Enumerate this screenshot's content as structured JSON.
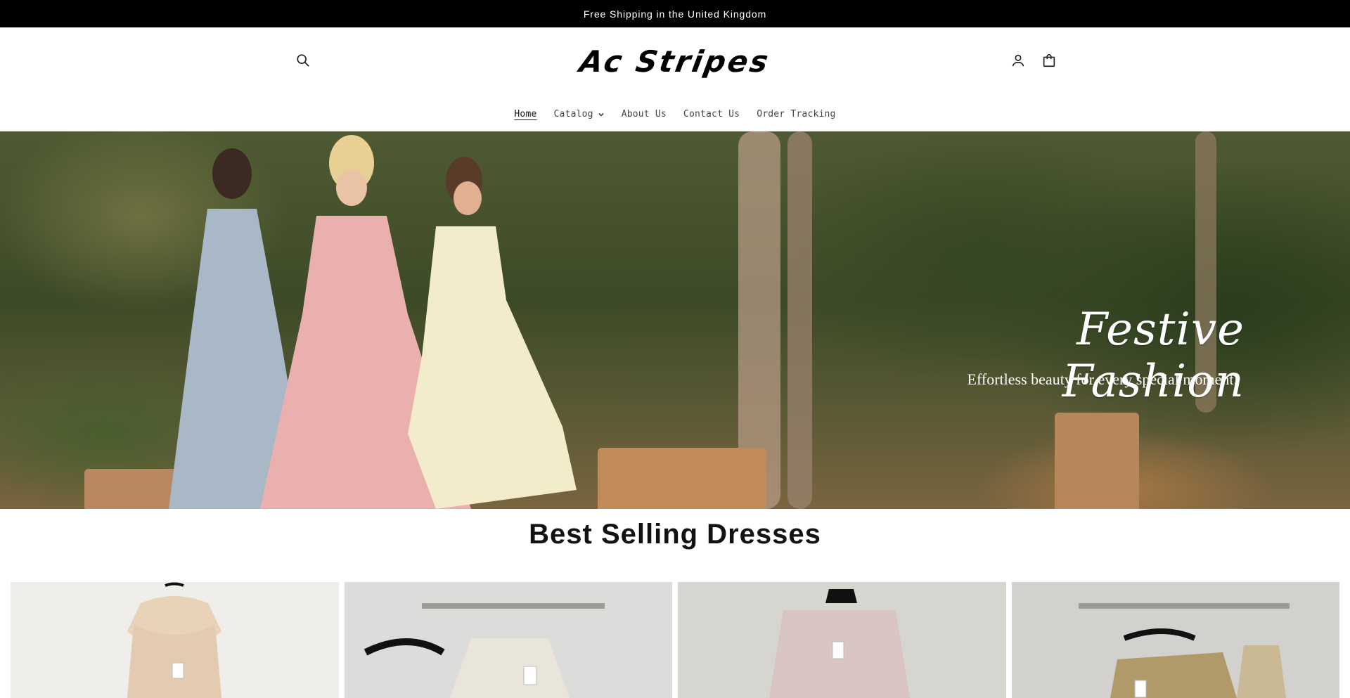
{
  "announcement": {
    "text": "Free Shipping in the United Kingdom"
  },
  "header": {
    "logo_text": "Ac Stripes",
    "icons": {
      "search": "search-icon",
      "account": "user-icon",
      "cart": "bag-icon"
    }
  },
  "nav": {
    "items": [
      {
        "label": "Home",
        "active": true
      },
      {
        "label": "Catalog",
        "has_dropdown": true
      },
      {
        "label": "About Us"
      },
      {
        "label": "Contact Us"
      },
      {
        "label": "Order Tracking"
      }
    ]
  },
  "hero": {
    "title": "Festive Fashion",
    "subtitle": "Effortless beauty for every special moment."
  },
  "best_selling": {
    "title": "Best Selling Dresses",
    "products": [
      {
        "bg": "#ecebe7"
      },
      {
        "bg": "#d9d9d7"
      },
      {
        "bg": "#d6d4cf"
      },
      {
        "bg": "#d0cfcc"
      }
    ]
  },
  "colors": {
    "announcement_bg": "#000000",
    "text": "#121212"
  }
}
